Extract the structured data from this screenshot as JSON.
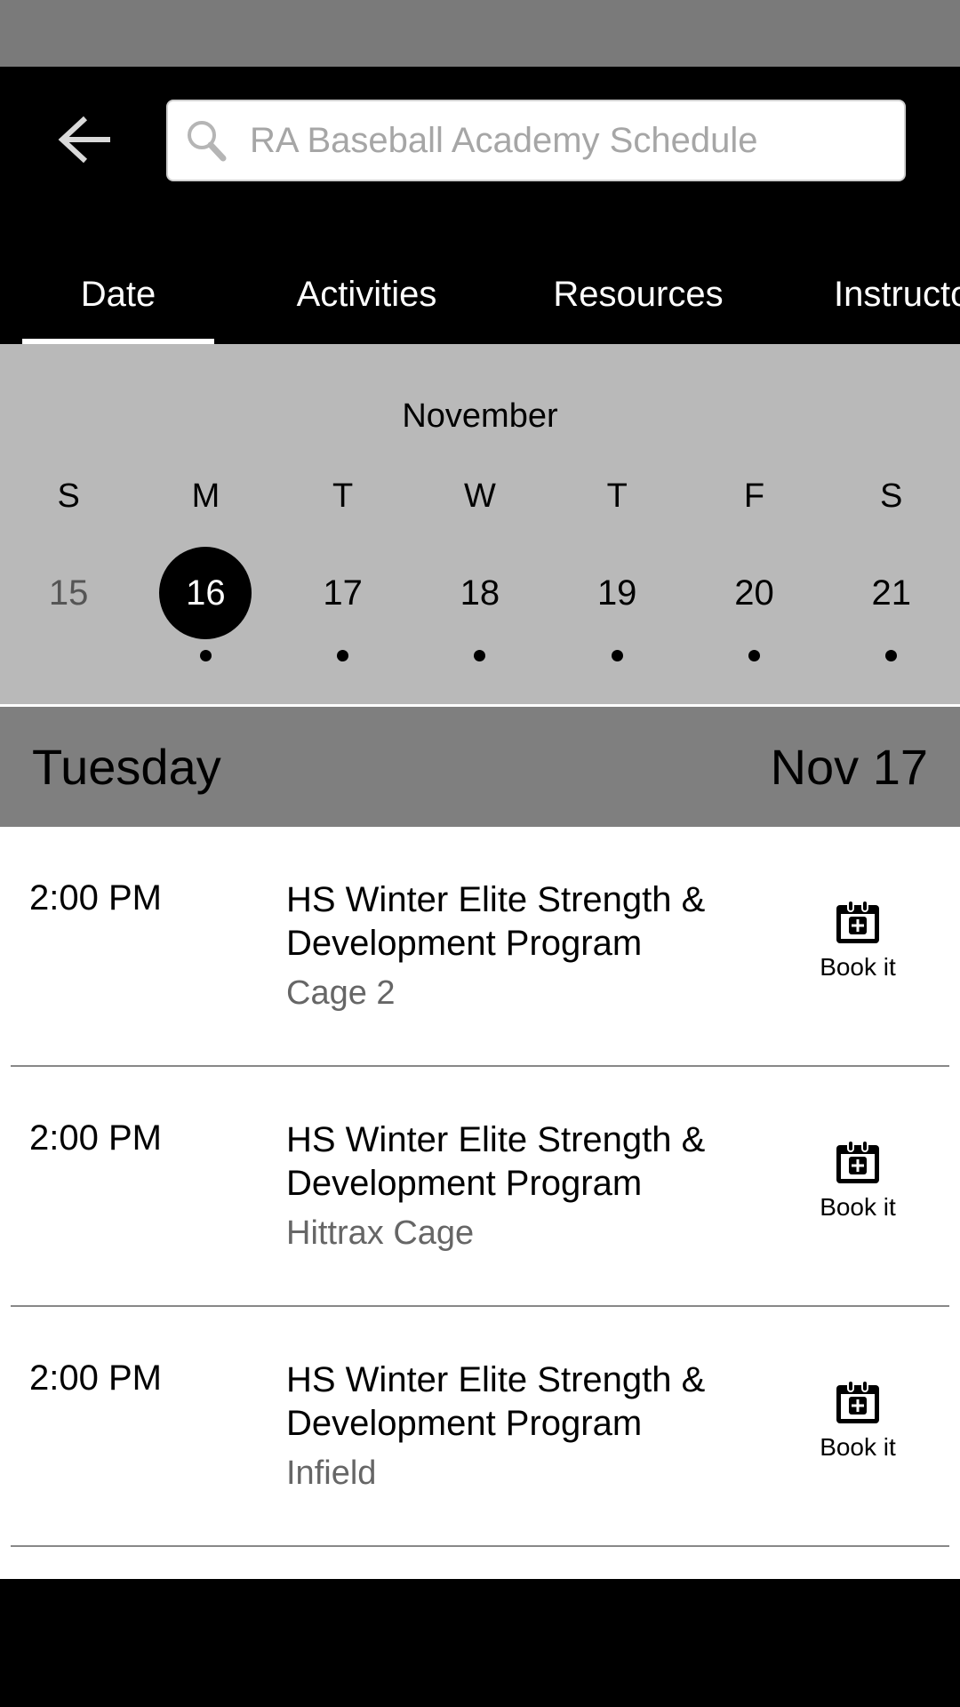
{
  "header": {
    "back_icon": "arrow-left-icon",
    "search": {
      "icon": "search-icon",
      "placeholder": "RA Baseball Academy Schedule",
      "value": ""
    }
  },
  "tabs": [
    {
      "label": "Date",
      "active": true
    },
    {
      "label": "Activities",
      "active": false
    },
    {
      "label": "Resources",
      "active": false
    },
    {
      "label": "Instructors",
      "active": false
    }
  ],
  "calendar": {
    "month": "November",
    "weekdays": [
      "S",
      "M",
      "T",
      "W",
      "T",
      "F",
      "S"
    ],
    "days": [
      {
        "number": "15",
        "state": "past",
        "has_events": false
      },
      {
        "number": "16",
        "state": "selected",
        "has_events": true
      },
      {
        "number": "17",
        "state": "normal",
        "has_events": true
      },
      {
        "number": "18",
        "state": "normal",
        "has_events": true
      },
      {
        "number": "19",
        "state": "normal",
        "has_events": true
      },
      {
        "number": "20",
        "state": "normal",
        "has_events": true
      },
      {
        "number": "21",
        "state": "normal",
        "has_events": true
      }
    ]
  },
  "day_header": {
    "day_name": "Tuesday",
    "date": "Nov 17"
  },
  "events": [
    {
      "time": "2:00 PM",
      "title": "HS Winter Elite Strength & Development Program",
      "resource": "Cage 2",
      "action_label": "Book it",
      "action_icon": "calendar-plus-icon"
    },
    {
      "time": "2:00 PM",
      "title": "HS Winter Elite Strength & Development Program",
      "resource": "Hittrax Cage",
      "action_label": "Book it",
      "action_icon": "calendar-plus-icon"
    },
    {
      "time": "2:00 PM",
      "title": "HS Winter Elite Strength & Development Program",
      "resource": "Infield",
      "action_label": "Book it",
      "action_icon": "calendar-plus-icon"
    }
  ],
  "colors": {
    "status_bar": "#7a7a7a",
    "header_bg": "#000000",
    "calendar_bg": "#b9b9b9",
    "day_header_bg": "#7f7f7f",
    "selected_day": "#000000",
    "resource_text": "#666666"
  }
}
